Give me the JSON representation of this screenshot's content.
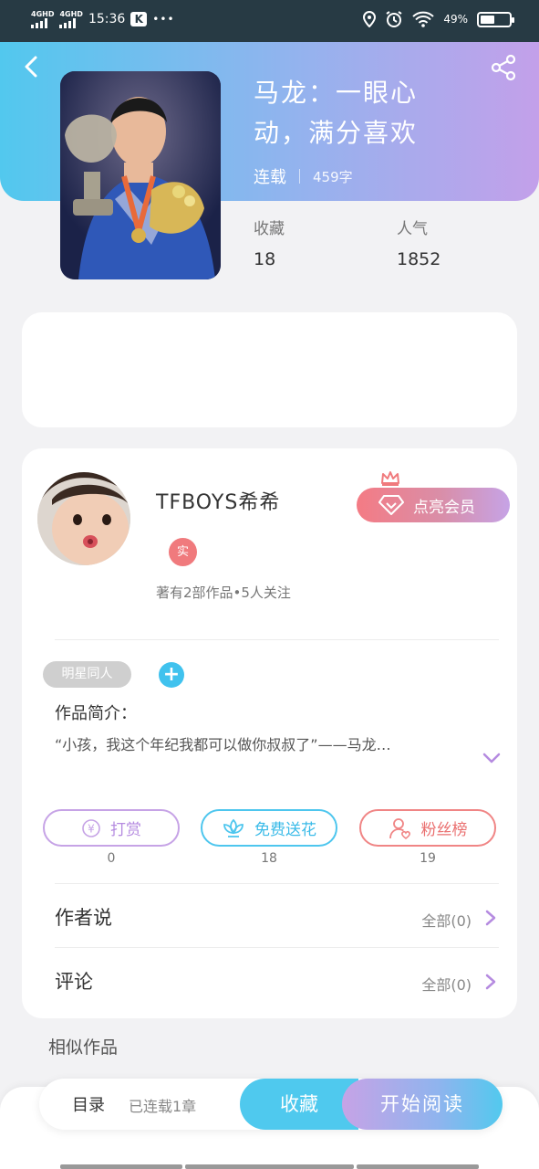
{
  "status_bar": {
    "net1": "4GHD",
    "net2": "4GHD",
    "time": "15:36",
    "app_badge": "K",
    "more": "•••",
    "battery": "49%",
    "battery_level": 0.49
  },
  "book": {
    "title_line1": "马龙：一眼心",
    "title_line2": "动，满分喜欢",
    "status": "连载",
    "word_count": "459字",
    "stats": [
      {
        "label": "收藏",
        "value": "18"
      },
      {
        "label": "人气",
        "value": "1852"
      }
    ]
  },
  "author": {
    "name": "TFBOYS希希",
    "real_badge": "实",
    "subtitle": "著有2部作品•5人关注",
    "vip_label": "点亮会员"
  },
  "tag": "明星同人",
  "add_tag": "+",
  "intro": {
    "label": "作品简介：",
    "text": "“小孩，我这个年纪我都可以做你叔叔了”——马龙…"
  },
  "actions": [
    {
      "label": "打赏",
      "count": "0",
      "icon_glyph": "¥"
    },
    {
      "label": "免费送花",
      "count": "18"
    },
    {
      "label": "粉丝榜",
      "count": "19"
    }
  ],
  "author_says": {
    "label": "作者说",
    "more": "全部(0)"
  },
  "comments": {
    "label": "评论",
    "more": "全部(0)"
  },
  "similar_label": "相似作品",
  "bottom": {
    "toc": "目录",
    "toc_sub": "已连载1章",
    "favorite": "收藏",
    "start_reading": "开始阅读"
  },
  "colors": {
    "accent_blue": "#4fc9ee",
    "accent_purple": "#c6a3e6",
    "accent_red": "#f07a7d",
    "statusbar_bg": "#273a44"
  }
}
